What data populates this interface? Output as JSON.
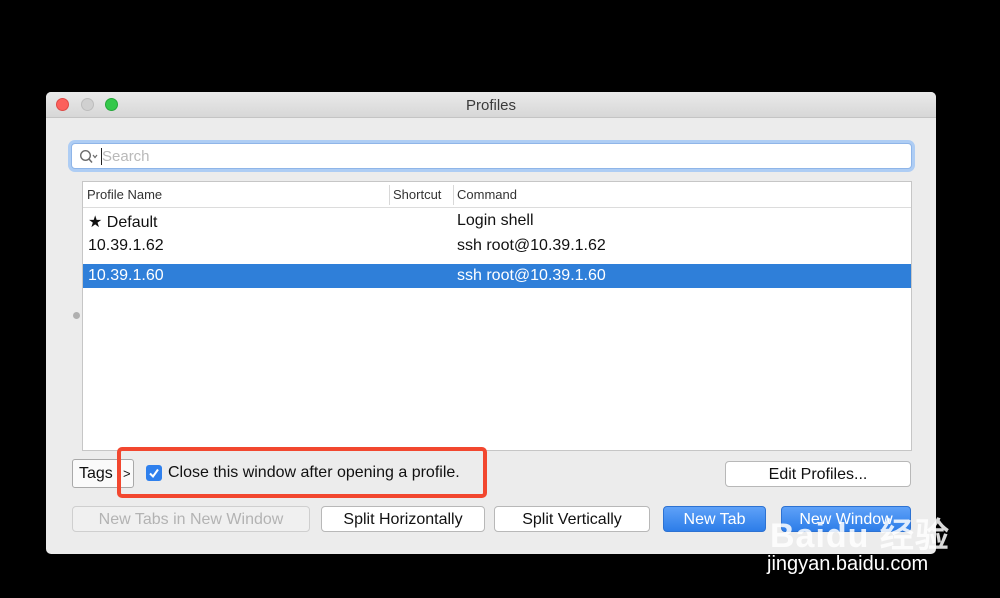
{
  "window": {
    "title": "Profiles"
  },
  "search": {
    "placeholder": "Search",
    "value": ""
  },
  "table": {
    "columns": [
      "Profile Name",
      "Shortcut",
      "Command"
    ],
    "rows": [
      {
        "name": "★ Default",
        "shortcut": "",
        "command": "Login shell",
        "selected": false
      },
      {
        "name": "10.39.1.62",
        "shortcut": "",
        "command": "ssh root@10.39.1.62",
        "selected": false
      },
      {
        "name": "10.39.1.60",
        "shortcut": "",
        "command": "ssh root@10.39.1.60",
        "selected": true
      }
    ]
  },
  "tags": {
    "label": "Tags",
    "arrow": ">"
  },
  "option": {
    "label": "Close this window after opening a profile.",
    "checked": true
  },
  "buttons": {
    "edit_profiles": "Edit Profiles...",
    "new_tabs_in_new_window": "New Tabs in New Window",
    "split_horizontally": "Split Horizontally",
    "split_vertically": "Split Vertically",
    "new_tab": "New Tab",
    "new_window": "New Window"
  },
  "watermark": {
    "logo": "Baidu 经验",
    "url": "jingyan.baidu.com"
  },
  "colors": {
    "selection": "#2f7fd9",
    "highlight_box": "#f2472f",
    "primary_button": "#2d7de8"
  }
}
